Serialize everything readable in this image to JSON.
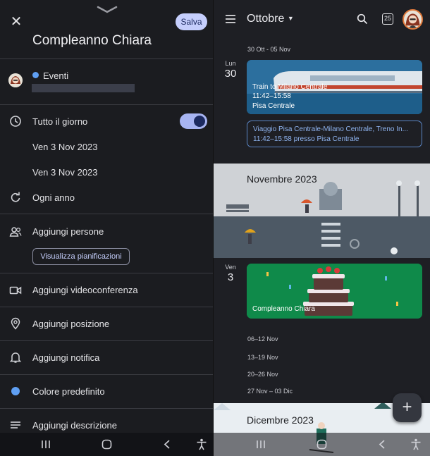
{
  "editor": {
    "close_icon": "close-icon",
    "save_label": "Salva",
    "title": "Compleanno Chiara",
    "calendar_name": "Eventi",
    "all_day_label": "Tutto il giorno",
    "all_day_on": true,
    "start_date": "Ven 3 Nov 2023",
    "end_date": "Ven 3 Nov 2023",
    "repeat_label": "Ogni anno",
    "add_people_label": "Aggiungi persone",
    "view_schedules_label": "Visualizza pianificazioni",
    "video_label": "Aggiungi videoconferenza",
    "location_label": "Aggiungi posizione",
    "notification_label": "Aggiungi notifica",
    "color_label": "Colore predefinito",
    "color_hex": "#5f9ff3",
    "description_label": "Aggiungi descrizione"
  },
  "calendar": {
    "month_label": "Ottobre",
    "today_badge": "25",
    "week1": "30 Ott - 05 Nov",
    "day1_name": "Lun",
    "day1_num": "30",
    "event1": {
      "title": "Train to Milano Centrale",
      "time": "11:42–15:58",
      "place": "Pisa Centrale"
    },
    "event2": {
      "title": "Viaggio Pisa Centrale-Milano Centrale, Treno In...",
      "detail": "11:42–15:58 presso Pisa Centrale"
    },
    "nov_banner": "Novembre 2023",
    "day2_name": "Ven",
    "day2_num": "3",
    "event3": {
      "title": "Compleanno Chiara"
    },
    "weeks": [
      "06–12 Nov",
      "13–19 Nov",
      "20–26 Nov",
      "27 Nov – 03 Dic"
    ],
    "dec_banner": "Dicembre 2023",
    "fab_icon": "plus-icon"
  },
  "colors": {
    "accent": "#c5cefc",
    "event_blue": "#1b6aa7",
    "event_green": "#0b8043"
  }
}
